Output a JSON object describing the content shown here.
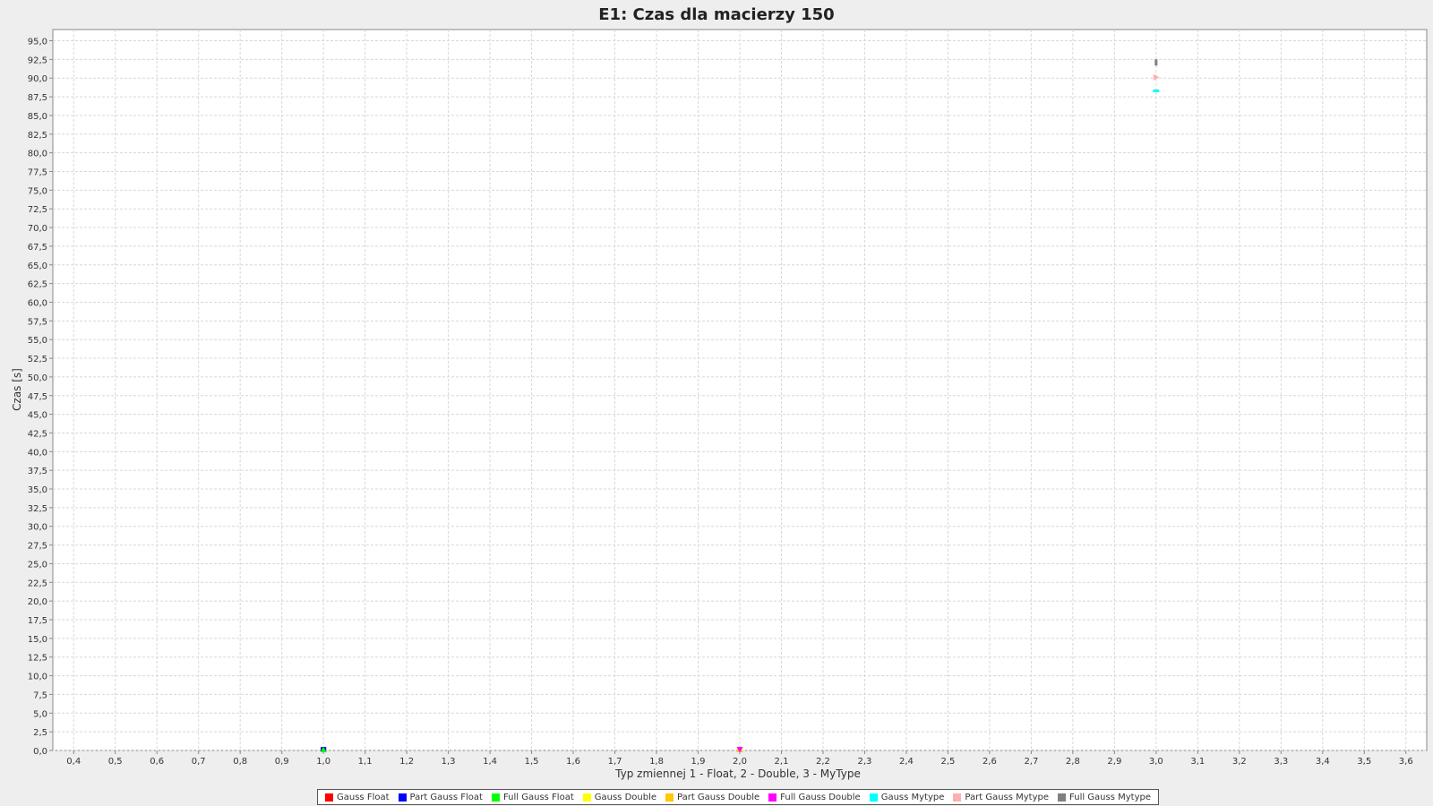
{
  "chart_data": {
    "type": "scatter",
    "title": "E1: Czas dla macierzy 150",
    "xlabel": "Typ zmiennej 1 - Float, 2 - Double, 3 - MyType",
    "ylabel": "Czas [s]",
    "xlim": [
      0.35,
      3.65
    ],
    "ylim": [
      0,
      96.5
    ],
    "x_ticks": [
      "0,4",
      "0,5",
      "0,6",
      "0,7",
      "0,8",
      "0,9",
      "1,0",
      "1,1",
      "1,2",
      "1,3",
      "1,4",
      "1,5",
      "1,6",
      "1,7",
      "1,8",
      "1,9",
      "2,0",
      "2,1",
      "2,2",
      "2,3",
      "2,4",
      "2,5",
      "2,6",
      "2,7",
      "2,8",
      "2,9",
      "3,0",
      "3,1",
      "3,2",
      "3,3",
      "3,4",
      "3,5",
      "3,6"
    ],
    "y_ticks": [
      "0,0",
      "2,5",
      "5,0",
      "7,5",
      "10,0",
      "12,5",
      "15,0",
      "17,5",
      "20,0",
      "22,5",
      "25,0",
      "27,5",
      "30,0",
      "32,5",
      "35,0",
      "37,5",
      "40,0",
      "42,5",
      "45,0",
      "47,5",
      "50,0",
      "52,5",
      "55,0",
      "57,5",
      "60,0",
      "62,5",
      "65,0",
      "67,5",
      "70,0",
      "72,5",
      "75,0",
      "77,5",
      "80,0",
      "82,5",
      "85,0",
      "87,5",
      "90,0",
      "92,5",
      "95,0"
    ],
    "grid": true,
    "legend_position": "bottom",
    "series": [
      {
        "name": "Gauss Float",
        "color": "#ff0000",
        "marker": "square",
        "x": [
          1.0
        ],
        "y": [
          0.05
        ]
      },
      {
        "name": "Part Gauss Float",
        "color": "#0000ff",
        "marker": "square",
        "x": [
          1.0
        ],
        "y": [
          0.06
        ]
      },
      {
        "name": "Full Gauss Float",
        "color": "#00ff00",
        "marker": "triangle-up",
        "x": [
          1.0
        ],
        "y": [
          0.07
        ]
      },
      {
        "name": "Gauss Double",
        "color": "#ffff00",
        "marker": "diamond",
        "x": [
          2.0
        ],
        "y": [
          0.05
        ]
      },
      {
        "name": "Part Gauss Double",
        "color": "#ffc800",
        "marker": "triangle-up",
        "x": [
          2.0
        ],
        "y": [
          0.06
        ]
      },
      {
        "name": "Full Gauss Double",
        "color": "#ff00ff",
        "marker": "triangle-down",
        "x": [
          2.0
        ],
        "y": [
          0.08
        ]
      },
      {
        "name": "Gauss Mytype",
        "color": "#00ffff",
        "marker": "rect-h",
        "x": [
          3.0
        ],
        "y": [
          88.3
        ]
      },
      {
        "name": "Part Gauss Mytype",
        "color": "#ffafaf",
        "marker": "triangle-right",
        "x": [
          3.0
        ],
        "y": [
          90.1
        ]
      },
      {
        "name": "Full Gauss Mytype",
        "color": "#808080",
        "marker": "rect-v",
        "x": [
          3.0
        ],
        "y": [
          92.1
        ]
      }
    ]
  }
}
